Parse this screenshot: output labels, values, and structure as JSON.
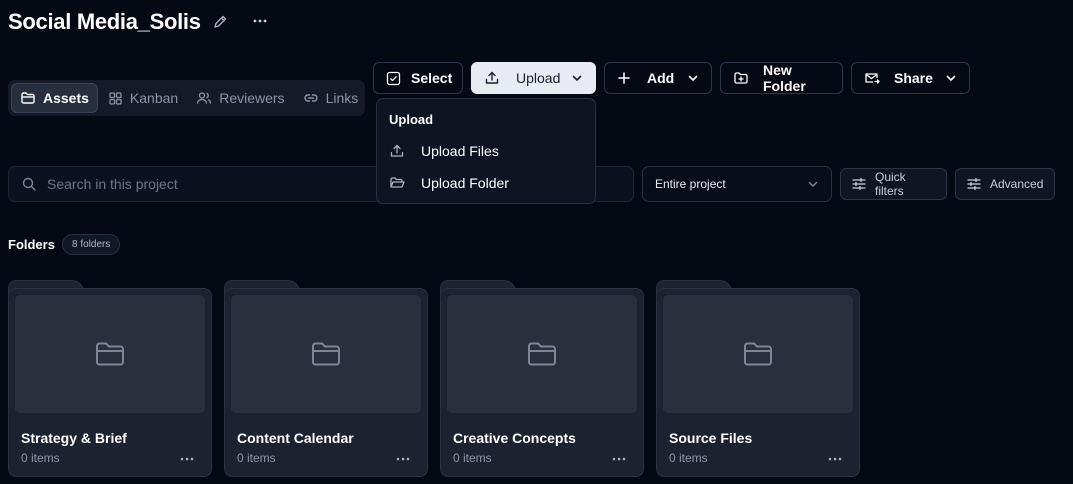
{
  "project": {
    "title": "Social Media_Solis"
  },
  "view_tabs": [
    {
      "label": "Assets",
      "icon": "folder-icon",
      "active": true
    },
    {
      "label": "Kanban",
      "icon": "grid-icon",
      "active": false
    },
    {
      "label": "Reviewers",
      "icon": "users-icon",
      "active": false
    },
    {
      "label": "Links",
      "icon": "link-icon",
      "active": false
    }
  ],
  "toolbar": {
    "select_label": "Select",
    "upload_label": "Upload",
    "add_label": "Add",
    "new_folder_label": "New Folder",
    "share_label": "Share"
  },
  "upload_menu": {
    "header": "Upload",
    "items": [
      {
        "label": "Upload Files",
        "icon": "upload-icon"
      },
      {
        "label": "Upload Folder",
        "icon": "folder-open-icon"
      }
    ]
  },
  "search": {
    "placeholder": "Search in this project",
    "value": ""
  },
  "scope_select": {
    "value": "Entire project"
  },
  "filters": {
    "quick_label": "Quick filters",
    "advanced_label": "Advanced"
  },
  "folders": {
    "label": "Folders",
    "count_label": "8 folders",
    "items": [
      {
        "name": "Strategy & Brief",
        "items": "0 items"
      },
      {
        "name": "Content Calendar",
        "items": "0 items"
      },
      {
        "name": "Creative Concepts",
        "items": "0 items"
      },
      {
        "name": "Source Files",
        "items": "0 items"
      }
    ]
  },
  "colors": {
    "background": "#050914",
    "primary_button": "#e8ebf1",
    "card": "#1d2230"
  }
}
